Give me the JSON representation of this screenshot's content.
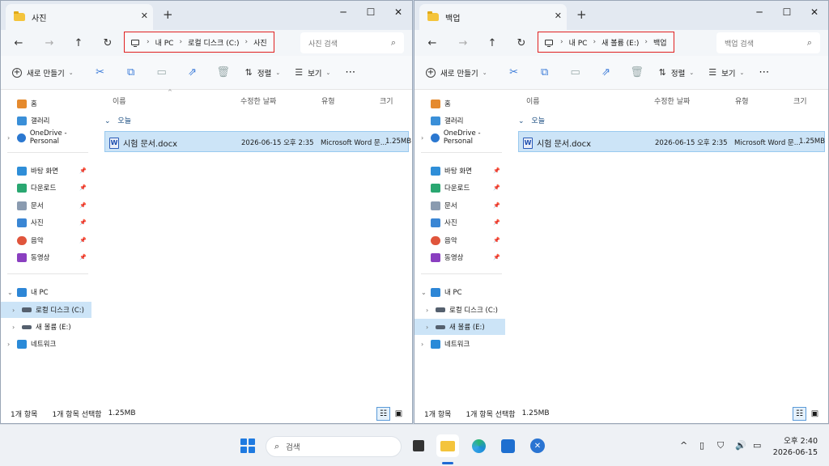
{
  "window1": {
    "tab_title": "사진",
    "address": {
      "root": "내 PC",
      "drive": "로컬 디스크 (C:)",
      "folder": "사진"
    },
    "search_placeholder": "사진 검색",
    "status": {
      "count": "1개 항목",
      "selected": "1개 항목 선택함",
      "size": "1.25MB"
    }
  },
  "window2": {
    "tab_title": "백업",
    "address": {
      "root": "내 PC",
      "drive": "새 볼륨 (E:)",
      "folder": "백업"
    },
    "search_placeholder": "백업 검색",
    "status": {
      "count": "1개 항목",
      "selected": "1개 항목 선택함",
      "size": "1.25MB"
    }
  },
  "toolbar": {
    "new": "새로 만들기",
    "sort": "정렬",
    "view": "보기",
    "more": "⋯"
  },
  "sidebar": {
    "home": "홈",
    "gallery": "갤러리",
    "onedrive": "OneDrive - Personal",
    "desktop": "바탕 화면",
    "downloads": "다운로드",
    "documents": "문서",
    "pictures": "사진",
    "music": "음악",
    "videos": "동영상",
    "this_pc": "내 PC",
    "local_disk": "로컬 디스크 (C:)",
    "new_volume": "새 볼륨 (E:)",
    "network": "네트워크"
  },
  "columns": {
    "name": "이름",
    "modified": "수정한 날짜",
    "type": "유형",
    "size": "크기"
  },
  "group_label": "오늘",
  "file": {
    "name": "시험 문서.docx",
    "modified": "2026-06-15 오후 2:35",
    "type": "Microsoft Word 문...",
    "size": "1.25MB"
  },
  "taskbar": {
    "search_label": "검색",
    "time": "오후 2:40",
    "date": "2026-06-15"
  }
}
